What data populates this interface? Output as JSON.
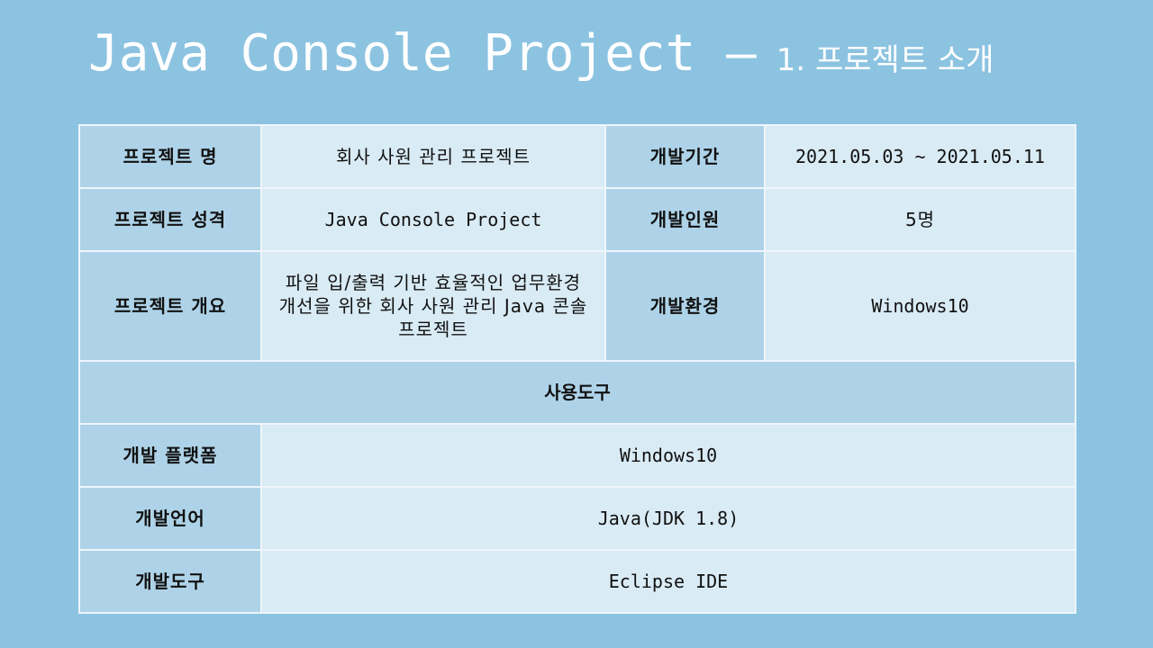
{
  "slide": {
    "title_main": "Java Console Project –",
    "title_sub": "1. 프로젝트 소개"
  },
  "project": {
    "name_label": "프로젝트 명",
    "name_value": "회사 사원 관리 프로젝트",
    "period_label": "개발기간",
    "period_value": "2021.05.03 ~ 2021.05.11",
    "nature_label": "프로젝트 성격",
    "nature_value": "Java Console Project",
    "members_label": "개발인원",
    "members_value": "5명",
    "overview_label": "프로젝트 개요",
    "overview_value": "파일 입/출력 기반 효율적인 업무환경 개선을 위한 회사 사원 관리 Java 콘솔 프로젝트",
    "env_label": "개발환경",
    "env_value": "Windows10"
  },
  "tools": {
    "section_label": "사용도구",
    "platform_label": "개발 플랫폼",
    "platform_value": "Windows10",
    "language_label": "개발언어",
    "language_value": "Java(JDK 1.8)",
    "ide_label": "개발도구",
    "ide_value": "Eclipse IDE"
  }
}
